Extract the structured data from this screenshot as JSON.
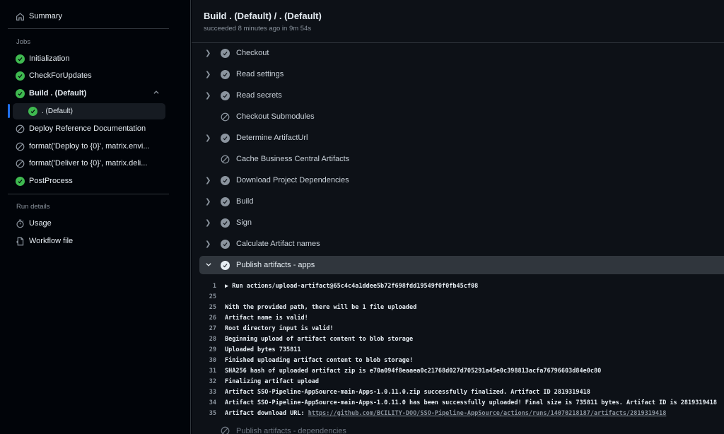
{
  "sidebar": {
    "summary": "Summary",
    "jobs_heading": "Jobs",
    "jobs": [
      {
        "label": "Initialization",
        "status": "success"
      },
      {
        "label": "CheckForUpdates",
        "status": "success"
      },
      {
        "label": "Build . (Default)",
        "status": "success"
      },
      {
        "label": "Deploy Reference Documentation",
        "status": "skipped"
      },
      {
        "label": "format('Deploy to {0}', matrix.envi...",
        "status": "skipped"
      },
      {
        "label": "format('Deliver to {0}', matrix.deli...",
        "status": "skipped"
      },
      {
        "label": "PostProcess",
        "status": "success"
      }
    ],
    "sub_job": ". (Default)",
    "run_details_heading": "Run details",
    "usage": "Usage",
    "workflow_file": "Workflow file"
  },
  "main": {
    "title": "Build . (Default) / . (Default)",
    "subtitle": "succeeded 8 minutes ago in 9m 54s",
    "steps": [
      {
        "label": "Checkout",
        "status": "success"
      },
      {
        "label": "Read settings",
        "status": "success"
      },
      {
        "label": "Read secrets",
        "status": "success"
      },
      {
        "label": "Checkout Submodules",
        "status": "skipped"
      },
      {
        "label": "Determine ArtifactUrl",
        "status": "success"
      },
      {
        "label": "Cache Business Central Artifacts",
        "status": "skipped"
      },
      {
        "label": "Download Project Dependencies",
        "status": "success"
      },
      {
        "label": "Build",
        "status": "success"
      },
      {
        "label": "Sign",
        "status": "success"
      },
      {
        "label": "Calculate Artifact names",
        "status": "success"
      },
      {
        "label": "Publish artifacts - apps",
        "status": "success"
      }
    ],
    "log": [
      {
        "n": "1",
        "text": "▶ Run actions/upload-artifact@65c4c4a1ddee5b72f698fdd19549f0f0fb45cf08"
      },
      {
        "n": "25",
        "text": ""
      },
      {
        "n": "25",
        "text": "With the provided path, there will be 1 file uploaded"
      },
      {
        "n": "26",
        "text": "Artifact name is valid!"
      },
      {
        "n": "27",
        "text": "Root directory input is valid!"
      },
      {
        "n": "28",
        "text": "Beginning upload of artifact content to blob storage"
      },
      {
        "n": "29",
        "text": "Uploaded bytes 735811"
      },
      {
        "n": "30",
        "text": "Finished uploading artifact content to blob storage!"
      },
      {
        "n": "31",
        "text": "SHA256 hash of uploaded artifact zip is e70a094f8eaaea0c21768d027d705291a45e0c398813acfa76796603d84e0c80"
      },
      {
        "n": "32",
        "text": "Finalizing artifact upload"
      },
      {
        "n": "33",
        "text": "Artifact SSO-Pipeline-AppSource-main-Apps-1.0.11.0.zip successfully finalized. Artifact ID 2819319418"
      },
      {
        "n": "34",
        "text": "Artifact SSO-Pipeline-AppSource-main-Apps-1.0.11.0 has been successfully uploaded! Final size is 735811 bytes. Artifact ID is 2819319418"
      },
      {
        "n": "35",
        "text": "Artifact download URL: ",
        "link": "https://github.com/BCILITY-DOO/SSO-Pipeline-AppSource/actions/runs/14070218187/artifacts/2819319418"
      }
    ],
    "next_step": "Publish artifacts - dependencies"
  },
  "icons": {
    "summary": "home-icon",
    "success": "check-circle-icon",
    "skipped": "skip-icon",
    "usage": "stopwatch-icon",
    "workflow_file": "file-icon"
  },
  "colors": {
    "success": "#3fb950",
    "accent": "#1f6feb",
    "background": "#0d1117",
    "sidebar": "#010409"
  }
}
